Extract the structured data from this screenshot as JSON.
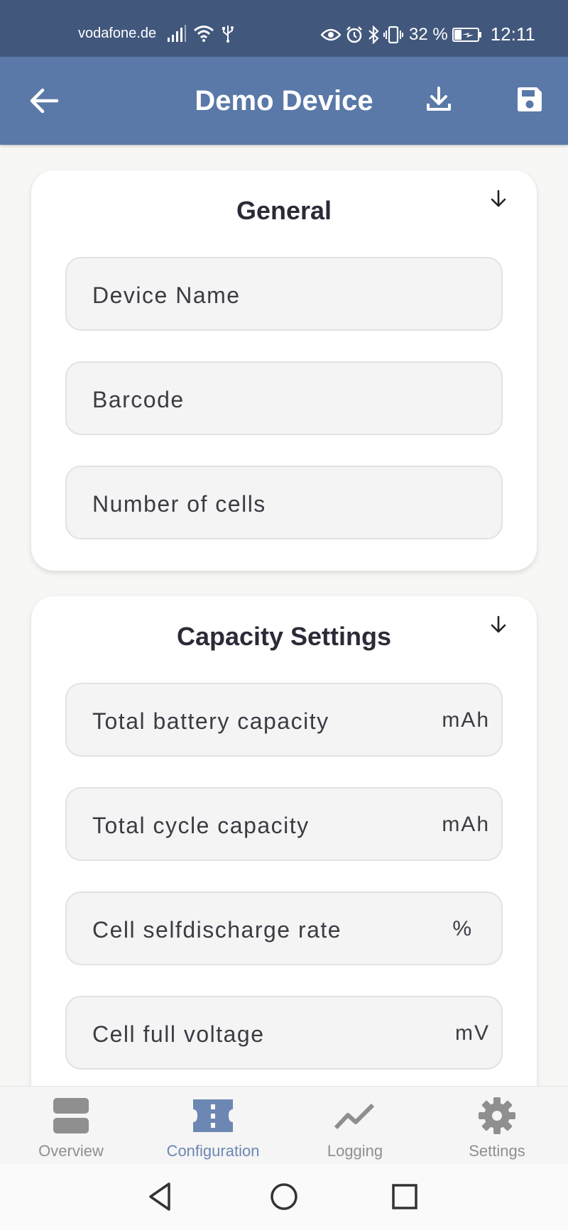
{
  "status_bar": {
    "carrier": "vodafone.de",
    "battery_percent": "32 %",
    "time": "12:11",
    "icons_left": [
      "signal-icon",
      "wifi-icon",
      "usb-icon"
    ],
    "icons_right": [
      "eye-icon",
      "alarm-icon",
      "bluetooth-icon",
      "vibrate-icon",
      "battery-charging-icon"
    ]
  },
  "app_bar": {
    "title": "Demo Device",
    "back_icon": "arrow-back-icon",
    "download_icon": "download-icon",
    "save_icon": "save-icon"
  },
  "sections": [
    {
      "title": "General",
      "fields": [
        {
          "label": "Device Name",
          "unit": ""
        },
        {
          "label": "Barcode",
          "unit": ""
        },
        {
          "label": "Number of cells",
          "unit": ""
        }
      ]
    },
    {
      "title": "Capacity Settings",
      "fields": [
        {
          "label": "Total battery capacity",
          "unit": "mAh"
        },
        {
          "label": "Total cycle capacity",
          "unit": "mAh"
        },
        {
          "label": "Cell selfdischarge rate",
          "unit": "%"
        },
        {
          "label": "Cell full voltage",
          "unit": "mV"
        }
      ]
    }
  ],
  "bottom_nav": {
    "active": "Configuration",
    "items": [
      {
        "label": "Overview",
        "icon": "overview-icon"
      },
      {
        "label": "Configuration",
        "icon": "configuration-icon"
      },
      {
        "label": "Logging",
        "icon": "chart-icon"
      },
      {
        "label": "Settings",
        "icon": "gear-icon"
      }
    ]
  },
  "colors": {
    "status_bar": "#42577c",
    "app_bar": "#5a78a8",
    "active_nav": "#6c87b3",
    "inactive_nav": "#8f8f8f"
  }
}
